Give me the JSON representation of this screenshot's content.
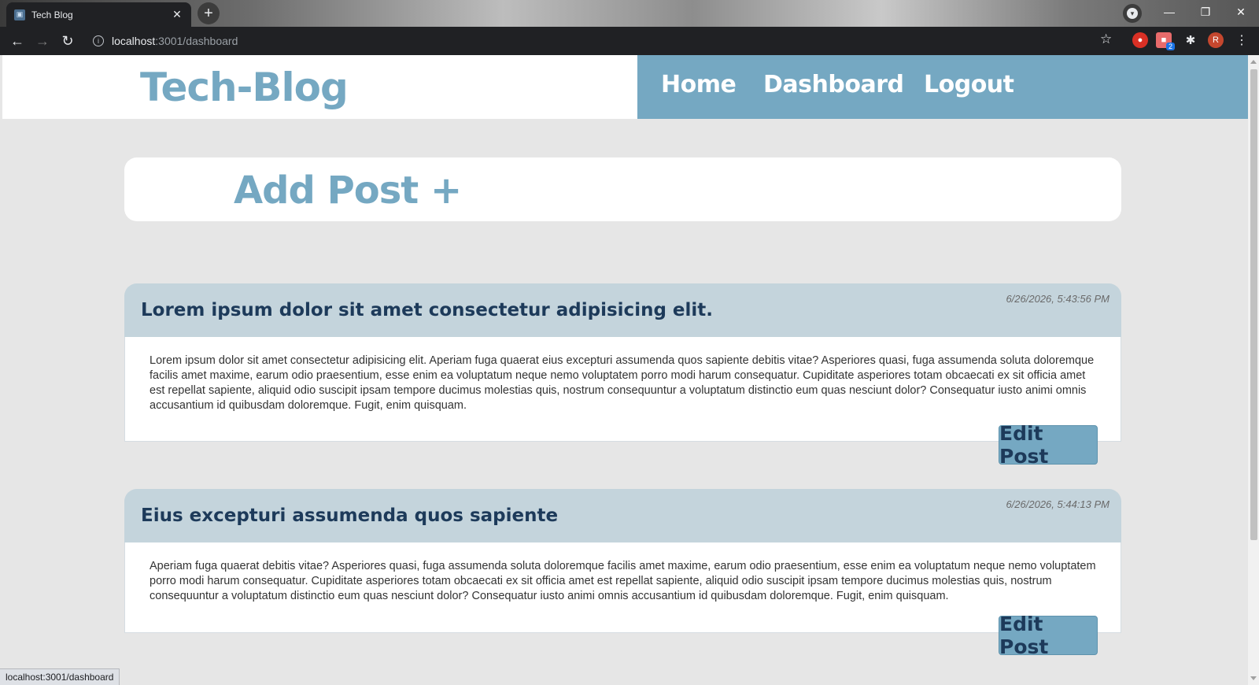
{
  "browser": {
    "tab_title": "Tech Blog",
    "url_host": "localhost",
    "url_path": ":3001/dashboard",
    "status_url": "localhost:3001/dashboard",
    "extension_badge": "2",
    "profile_initial": "R"
  },
  "header": {
    "logo": "Tech-Blog",
    "nav": [
      {
        "label": "Home"
      },
      {
        "label": "Dashboard"
      },
      {
        "label": "Logout"
      }
    ]
  },
  "add_post": {
    "label": "Add Post +"
  },
  "posts": [
    {
      "title": "Lorem ipsum dolor sit amet consectetur adipisicing elit.",
      "date": "6/26/2026, 5:43:56 PM",
      "body": "Lorem ipsum dolor sit amet consectetur adipisicing elit. Aperiam fuga quaerat eius excepturi assumenda quos sapiente debitis vitae? Asperiores quasi, fuga assumenda soluta doloremque facilis amet maxime, earum odio praesentium, esse enim ea voluptatum neque nemo voluptatem porro modi harum consequatur. Cupiditate asperiores totam obcaecati ex sit officia amet est repellat sapiente, aliquid odio suscipit ipsam tempore ducimus molestias quis, nostrum consequuntur a voluptatum distinctio eum quas nesciunt dolor? Consequatur iusto animi omnis accusantium id quibusdam doloremque. Fugit, enim quisquam.",
      "edit_label": "Edit Post"
    },
    {
      "title": "Eius excepturi assumenda quos sapiente",
      "date": "6/26/2026, 5:44:13 PM",
      "body": "Aperiam fuga quaerat debitis vitae? Asperiores quasi, fuga assumenda soluta doloremque facilis amet maxime, earum odio praesentium, esse enim ea voluptatum neque nemo voluptatem porro modi harum consequatur. Cupiditate asperiores totam obcaecati ex sit officia amet est repellat sapiente, aliquid odio suscipit ipsam tempore ducimus molestias quis, nostrum consequuntur a voluptatum distinctio eum quas nesciunt dolor? Consequatur iusto animi omnis accusantium id quibusdam doloremque. Fugit, enim quisquam.",
      "edit_label": "Edit Post"
    }
  ],
  "colors": {
    "accent": "#75a8c2",
    "post_header": "#c4d4dc",
    "title_text": "#1d3a5a",
    "page_bg": "#e6e6e6"
  }
}
